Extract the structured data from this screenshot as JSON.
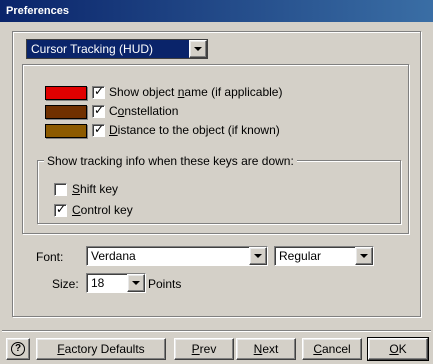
{
  "window": {
    "title": "Preferences"
  },
  "section_combo": {
    "value": "Cursor Tracking (HUD)"
  },
  "options": [
    {
      "label_pre": "Show object ",
      "label_u": "n",
      "label_post": "ame (if applicable)",
      "checked": true,
      "color": "#e00000"
    },
    {
      "label_pre": "C",
      "label_u": "o",
      "label_post": "nstellation",
      "checked": true,
      "color": "#703000"
    },
    {
      "label_pre": "",
      "label_u": "D",
      "label_post": "istance to the object (if known)",
      "checked": true,
      "color": "#8c5a00"
    }
  ],
  "keys_group": {
    "legend": "Show tracking info when these keys are down:",
    "shift": {
      "label_u": "S",
      "label_post": "hift key",
      "checked": false
    },
    "control": {
      "label_u": "C",
      "label_post": "ontrol key",
      "checked": true
    }
  },
  "font": {
    "label": "Font:",
    "family": "Verdana",
    "style": "Regular"
  },
  "size": {
    "label": "Size:",
    "value": "18",
    "unit": "Points"
  },
  "buttons": {
    "help": "?",
    "factory_pre": "",
    "factory_u": "F",
    "factory_post": "actory Defaults",
    "prev_pre": "",
    "prev_u": "P",
    "prev_post": "rev",
    "next_pre": "",
    "next_u": "N",
    "next_post": "ext",
    "cancel_pre": "",
    "cancel_u": "C",
    "cancel_post": "ancel",
    "ok_pre": "",
    "ok_u": "O",
    "ok_post": "K"
  }
}
